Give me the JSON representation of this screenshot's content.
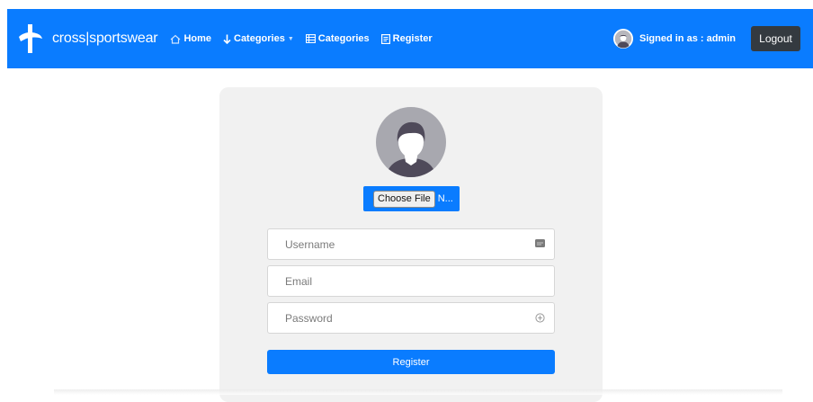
{
  "navbar": {
    "brand_text": "cross|sportswear",
    "links": [
      {
        "label": "Home",
        "icon": "home-icon"
      },
      {
        "label": "Categories",
        "icon": "arrow-down-icon",
        "dropdown": true
      },
      {
        "label": "Categories",
        "icon": "list-icon"
      },
      {
        "label": "Register",
        "icon": "register-icon"
      }
    ],
    "signed_in_text": "Signed in as : admin",
    "logout_label": "Logout"
  },
  "form": {
    "choose_file_label": "Choose File",
    "file_name": "N...",
    "username_placeholder": "Username",
    "email_placeholder": "Email",
    "password_placeholder": "Password",
    "submit_label": "Register"
  },
  "colors": {
    "primary": "#0a7cff",
    "card_bg": "#f1f1f1",
    "dark_button": "#343a40"
  }
}
